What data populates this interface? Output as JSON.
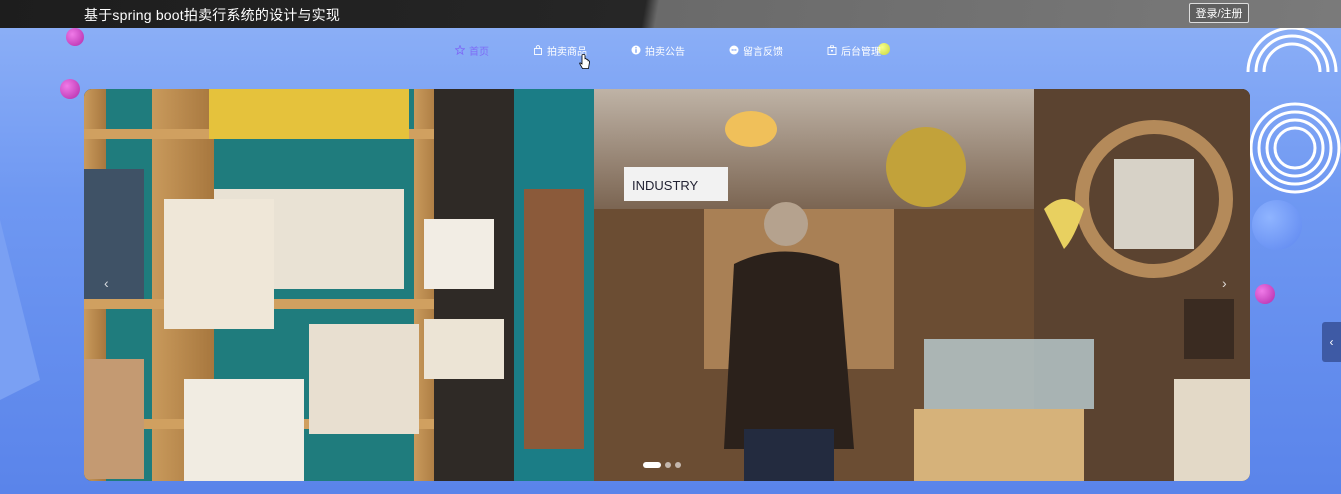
{
  "header": {
    "title": "基于spring boot拍卖行系统的设计与实现",
    "login_label": "登录/注册"
  },
  "nav": {
    "items": [
      {
        "label": "首页",
        "icon": "star-icon",
        "active": true
      },
      {
        "label": "拍卖商品",
        "icon": "bag-icon",
        "active": false
      },
      {
        "label": "拍卖公告",
        "icon": "info-icon",
        "active": false
      },
      {
        "label": "留言反馈",
        "icon": "message-icon",
        "active": false
      },
      {
        "label": "后台管理",
        "icon": "admin-icon",
        "active": false
      }
    ]
  },
  "carousel": {
    "prev_icon": "chevron-left-icon",
    "next_icon": "chevron-right-icon",
    "slide_count": 3,
    "active_index": 0,
    "shop_sign": "INDUSTRY"
  },
  "colors": {
    "active_nav": "#7e6cf6",
    "accent_ball": "#c93fc3"
  }
}
